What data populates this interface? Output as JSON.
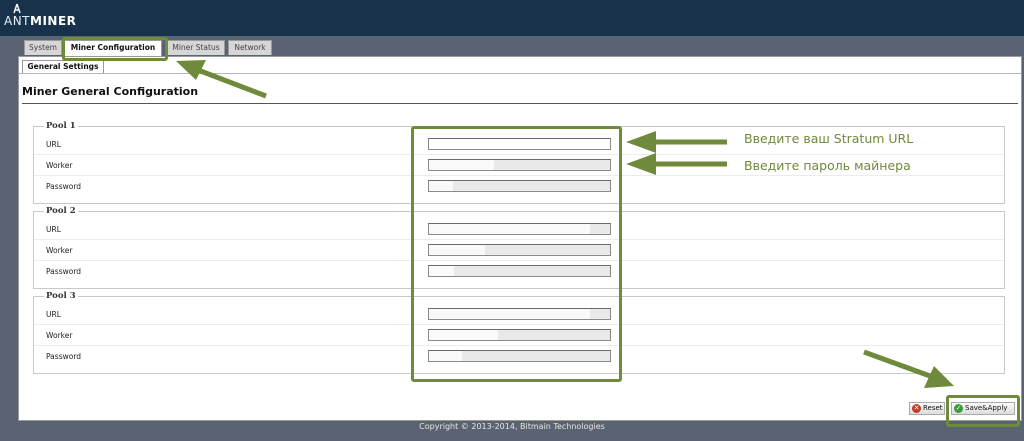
{
  "header": {
    "logo_prefix": "ANT",
    "logo_suffix": "MINER"
  },
  "tabs": [
    {
      "label": "System",
      "active": false
    },
    {
      "label": "Miner Configuration",
      "active": true
    },
    {
      "label": "Miner Status",
      "active": false
    },
    {
      "label": "Network",
      "active": false
    }
  ],
  "subtab": {
    "label": "General Settings"
  },
  "page_title": "Miner General Configuration",
  "pools": [
    {
      "legend": "Pool 1",
      "fields": [
        {
          "label": "URL",
          "value": ""
        },
        {
          "label": "Worker",
          "value": ""
        },
        {
          "label": "Password",
          "value": ""
        }
      ]
    },
    {
      "legend": "Pool 2",
      "fields": [
        {
          "label": "URL",
          "value": ""
        },
        {
          "label": "Worker",
          "value": ""
        },
        {
          "label": "Password",
          "value": ""
        }
      ]
    },
    {
      "legend": "Pool 3",
      "fields": [
        {
          "label": "URL",
          "value": ""
        },
        {
          "label": "Worker",
          "value": ""
        },
        {
          "label": "Password",
          "value": ""
        }
      ]
    }
  ],
  "buttons": {
    "reset_label": "Reset",
    "save_label": "Save&Apply"
  },
  "footer": {
    "copyright": "Copyright © 2013-2014, Bitmain Technologies"
  },
  "annotations": {
    "stratum_note": "Введите ваш Stratum URL",
    "password_note": "Введите пароль майнера",
    "color": "#6f8a3b"
  },
  "colors": {
    "header_bg": "#19324b",
    "content_bg": "#5a6371",
    "reset_icon": "#c0392b",
    "save_icon": "#3a9a3a"
  }
}
